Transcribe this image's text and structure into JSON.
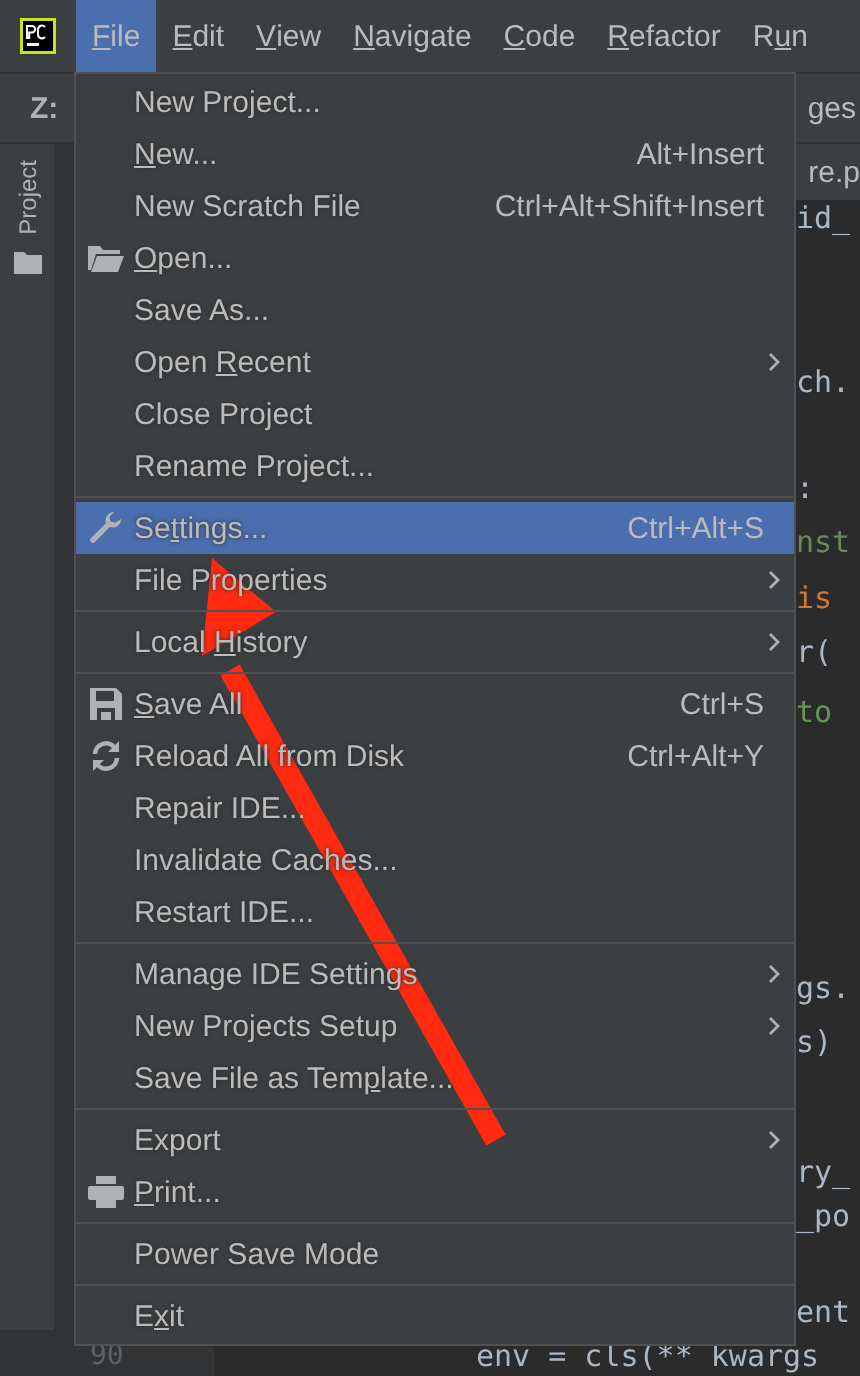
{
  "menubar": [
    {
      "key": "F",
      "post": "ile",
      "selected": true
    },
    {
      "key": "E",
      "post": "dit",
      "selected": false
    },
    {
      "key": "V",
      "post": "iew",
      "selected": false
    },
    {
      "key": "N",
      "post": "avigate",
      "selected": false
    },
    {
      "key": "C",
      "post": "ode",
      "selected": false
    },
    {
      "key": "R",
      "post": "efactor",
      "selected": false
    },
    {
      "pre": "R",
      "key": "u",
      "post": "n",
      "selected": false
    }
  ],
  "toolbar": {
    "label": "Z:",
    "tab_fragment": "ges"
  },
  "side_panel": {
    "label": "Project"
  },
  "editor_tab": {
    "label": "re.p"
  },
  "code_lines": [
    {
      "text": "id_",
      "kind": "plain"
    },
    {
      "text": "ch.",
      "kind": "plain"
    },
    {
      "text": ":",
      "kind": "plain"
    },
    {
      "text": "nst",
      "kind": "string"
    },
    {
      "text": "is",
      "kind": "keyword"
    },
    {
      "text": "r(",
      "kind": "plain"
    },
    {
      "text": "to",
      "kind": "comment"
    },
    {
      "text": "gs.",
      "kind": "plain"
    },
    {
      "text": "s)",
      "kind": "plain"
    },
    {
      "text": "ry_",
      "kind": "plain"
    },
    {
      "text": "_po",
      "kind": "plain"
    },
    {
      "text": "ent",
      "kind": "plain"
    }
  ],
  "bottom_line": {
    "line_number": "90",
    "text": "env = cls(** kwargs"
  },
  "file_menu": [
    {
      "kind": "plain",
      "pre": "New Project...",
      "selected": false,
      "submenu": false
    },
    {
      "kind": "plain",
      "key": "N",
      "post": "ew...",
      "shortcut": "Alt+Insert",
      "selected": false,
      "submenu": false
    },
    {
      "kind": "plain",
      "pre": "New Scratch File",
      "shortcut": "Ctrl+Alt+Shift+Insert",
      "selected": false,
      "submenu": false
    },
    {
      "kind": "folder",
      "key": "O",
      "post": "pen...",
      "selected": false,
      "submenu": false
    },
    {
      "kind": "plain",
      "pre": "Save As...",
      "selected": false,
      "submenu": false
    },
    {
      "kind": "plain",
      "pre": "Open ",
      "key": "R",
      "post": "ecent",
      "selected": false,
      "submenu": true
    },
    {
      "kind": "plain",
      "pre": "Close Project",
      "selected": false,
      "submenu": false
    },
    {
      "kind": "plain",
      "pre": "Rename Project...",
      "selected": false,
      "submenu": false
    },
    {
      "kind": "separator"
    },
    {
      "kind": "wrench",
      "pre": "Se",
      "key": "t",
      "post": "tings...",
      "shortcut": "Ctrl+Alt+S",
      "selected": true,
      "submenu": false
    },
    {
      "kind": "plain",
      "pre": "File Properties",
      "selected": false,
      "submenu": true
    },
    {
      "kind": "separator"
    },
    {
      "kind": "plain",
      "pre": "Local ",
      "key": "H",
      "post": "istory",
      "selected": false,
      "submenu": true
    },
    {
      "kind": "separator"
    },
    {
      "kind": "save",
      "key": "S",
      "post": "ave All",
      "shortcut": "Ctrl+S",
      "selected": false,
      "submenu": false
    },
    {
      "kind": "reload",
      "pre": "Reload All from Disk",
      "shortcut": "Ctrl+Alt+Y",
      "selected": false,
      "submenu": false
    },
    {
      "kind": "plain",
      "pre": "Repair IDE...",
      "selected": false,
      "submenu": false
    },
    {
      "kind": "plain",
      "pre": "Invalidate Caches...",
      "selected": false,
      "submenu": false
    },
    {
      "kind": "plain",
      "pre": "Restart IDE...",
      "selected": false,
      "submenu": false
    },
    {
      "kind": "separator"
    },
    {
      "kind": "plain",
      "pre": "Manage IDE Settings",
      "selected": false,
      "submenu": true
    },
    {
      "kind": "plain",
      "pre": "New Projects Setup",
      "selected": false,
      "submenu": true
    },
    {
      "kind": "plain",
      "pre": "Save File as Tem",
      "key": "p",
      "post": "late...",
      "selected": false,
      "submenu": false
    },
    {
      "kind": "separator"
    },
    {
      "kind": "plain",
      "pre": "Export",
      "selected": false,
      "submenu": true
    },
    {
      "kind": "printer",
      "key": "P",
      "post": "rint...",
      "selected": false,
      "submenu": false
    },
    {
      "kind": "separator"
    },
    {
      "kind": "plain",
      "pre": "Power Save Mode",
      "selected": false,
      "submenu": false
    },
    {
      "kind": "separator"
    },
    {
      "kind": "plain",
      "pre": "E",
      "key": "x",
      "post": "it",
      "selected": false,
      "submenu": false
    }
  ]
}
